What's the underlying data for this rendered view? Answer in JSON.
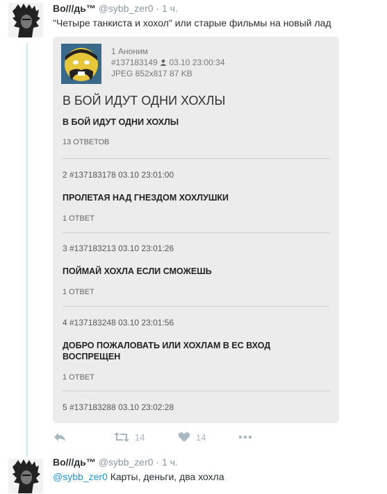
{
  "tweet1": {
    "name": "Во///дь™",
    "handle": "@sybb_zer0",
    "dot": "·",
    "time": "1 ч.",
    "text": "\"Четыре танкиста и хохол\" или старые фильмы на новый лад",
    "image": {
      "op_name": "1 Аноним",
      "op_id": "#137183149",
      "op_datetime": "03.10 23:00:34",
      "op_file": "JPEG 852x817 87 KB",
      "big_title": "В БОЙ ИДУТ ОДНИ ХОХЛЫ",
      "sub_title": "В БОЙ ИДУТ ОДНИ ХОХЛЫ",
      "answers": "13 ОТВЕТОВ",
      "posts": [
        {
          "head": "2 #137183178 03.10 23:01:00",
          "body": "ПРОЛЕТАЯ НАД ГНЕЗДОМ ХОХЛУШКИ",
          "ans": "1 ОТВЕТ"
        },
        {
          "head": "3 #137183213 03.10 23:01:26",
          "body": "ПОЙМАЙ ХОХЛА ЕСЛИ СМОЖЕШЬ",
          "ans": "1 ОТВЕТ"
        },
        {
          "head": "4 #137183248 03.10 23:01:56",
          "body": "ДОБРО ПОЖАЛОВАТЬ ИЛИ ХОХЛАМ В ЕС ВХОД ВОСПРЕЩЕН",
          "ans": "1 ОТВЕТ"
        },
        {
          "head": "5 #137183288 03.10 23:02:28",
          "body": "",
          "ans": ""
        }
      ]
    },
    "actions": {
      "reply_icon": "reply-icon",
      "retweet_icon": "retweet-icon",
      "retweet_count": "14",
      "like_icon": "heart-icon",
      "like_count": "14",
      "more_icon": "more-icon"
    }
  },
  "tweet2": {
    "name": "Во///дь™",
    "handle": "@sybb_zer0",
    "dot": "·",
    "time": "1 ч.",
    "mention": "@sybb_zer0",
    "text": " Карты, деньги, два хохла"
  },
  "colors": {
    "link": "#1b95e0",
    "muted": "#8899a6",
    "thread": "#cce4f4",
    "action": "#aab8c2"
  }
}
